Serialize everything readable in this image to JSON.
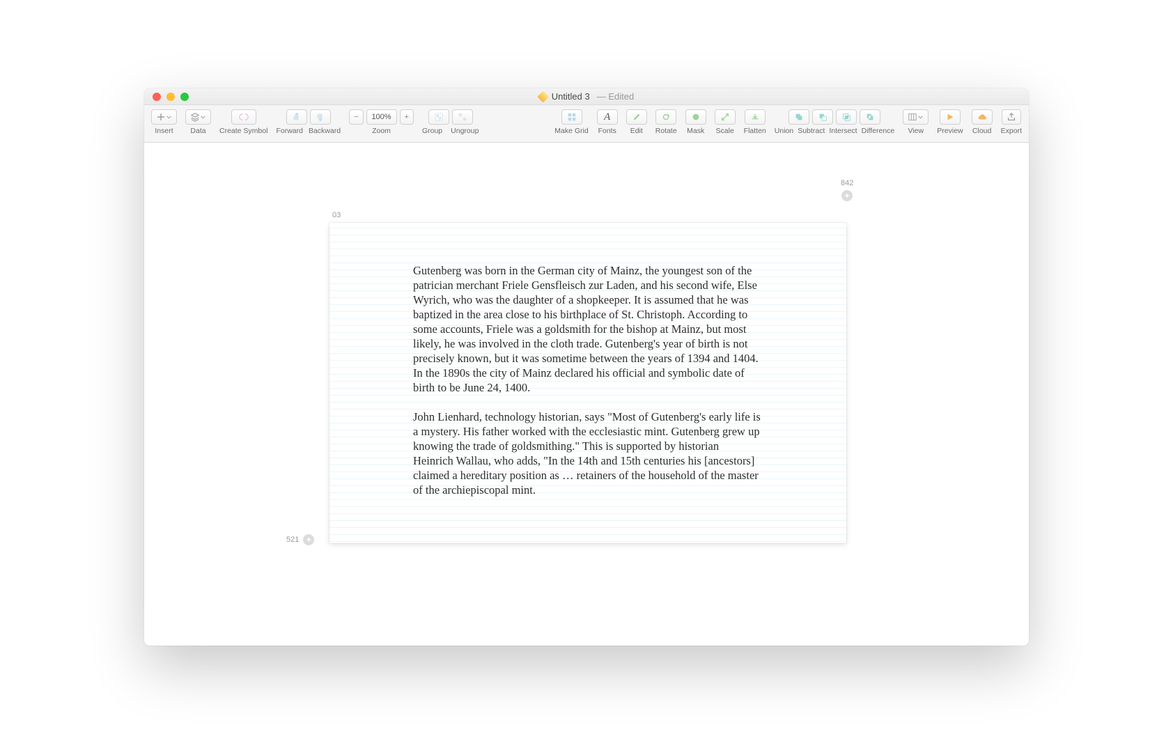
{
  "window": {
    "title": "Untitled 3",
    "edited_suffix": "— Edited"
  },
  "toolbar": {
    "insert": "Insert",
    "data": "Data",
    "create_symbol": "Create Symbol",
    "forward": "Forward",
    "backward": "Backward",
    "zoom": "Zoom",
    "zoom_value": "100%",
    "group": "Group",
    "ungroup": "Ungroup",
    "make_grid": "Make Grid",
    "fonts": "Fonts",
    "edit": "Edit",
    "rotate": "Rotate",
    "mask": "Mask",
    "scale": "Scale",
    "flatten": "Flatten",
    "union": "Union",
    "subtract": "Subtract",
    "intersect": "Intersect",
    "difference": "Difference",
    "view": "View",
    "preview": "Preview",
    "cloud": "Cloud",
    "export": "Export"
  },
  "canvas": {
    "artboard_label": "03",
    "dim_right": "842",
    "dim_bottom": "521",
    "paragraph1": "Gutenberg was born in the German city of Mainz, the youngest son of the patrician merchant Friele Gensfleisch zur Laden, and his second wife, Else Wyrich, who was the daughter of a shopkeeper. It is assumed that he was baptized in the area close to his birthplace of St. Christoph. According to some accounts, Friele was a goldsmith for the bishop at Mainz, but most likely, he was involved in the cloth trade. Gutenberg's year of birth is not precisely known, but it was sometime between the years of 1394 and 1404. In the 1890s the city of Mainz declared his official and symbolic date of birth to be June 24, 1400.",
    "paragraph2": "John Lienhard, technology historian, says \"Most of Gutenberg's early life is a mystery. His father worked with the ecclesiastic mint. Gutenberg grew up knowing the trade of goldsmithing.\" This is supported by historian Heinrich Wallau, who adds, \"In the 14th and 15th centuries his [ancestors] claimed a hereditary position as … retainers of the household of the master of the archiepiscopal mint."
  }
}
